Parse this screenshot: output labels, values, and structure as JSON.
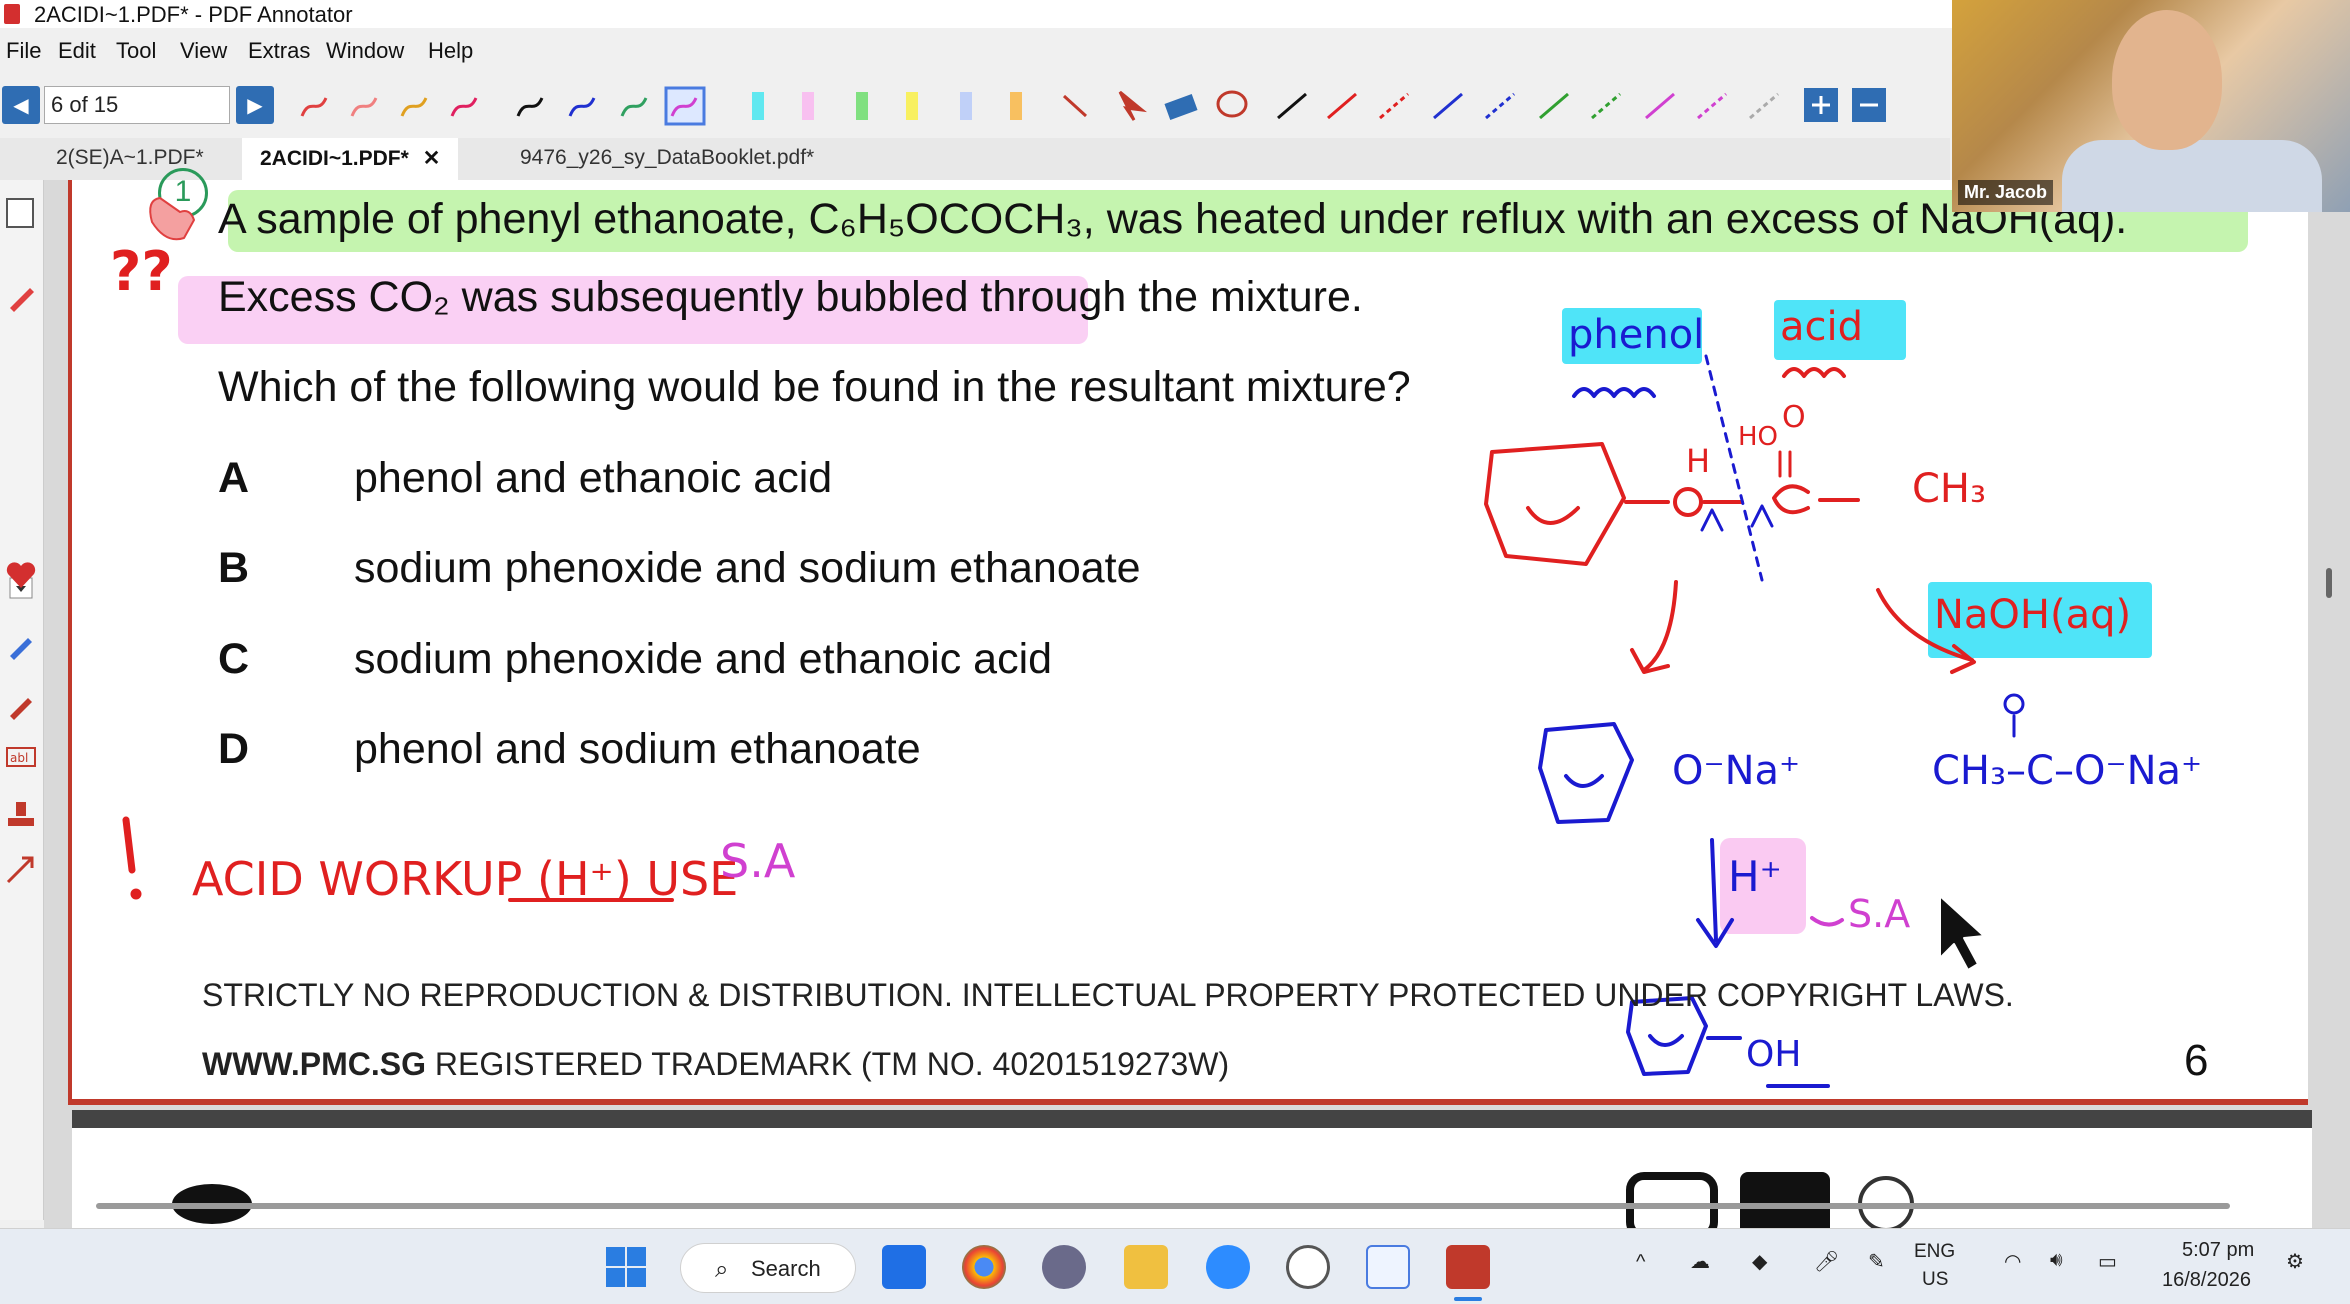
{
  "window": {
    "title": "2ACIDI~1.PDF* - PDF Annotator"
  },
  "menu": [
    "File",
    "Edit",
    "Tool",
    "View",
    "Extras",
    "Window",
    "Help"
  ],
  "toolbar": {
    "page_indicator": "6 of 15"
  },
  "tabs": [
    {
      "label": "2(SE)A~1.PDF*",
      "active": false
    },
    {
      "label": "2ACIDI~1.PDF*",
      "active": true
    },
    {
      "label": "9476_y26_sy_DataBooklet.pdf*",
      "active": false
    }
  ],
  "tab_close": "✕",
  "question": {
    "number": "1",
    "line1": "A sample of phenyl ethanoate, C₆H₅OCOCH₃, was heated under reflux with an excess of NaOH(aq).",
    "line2": "Excess CO₂ was subsequently bubbled through the mixture.",
    "line3": "Which of the following would be found in the resultant mixture?",
    "options": [
      {
        "letter": "A",
        "text": "phenol and ethanoic acid"
      },
      {
        "letter": "B",
        "text": "sodium phenoxide and sodium ethanoate"
      },
      {
        "letter": "C",
        "text": "sodium phenoxide and ethanoic acid"
      },
      {
        "letter": "D",
        "text": "phenol and sodium ethanoate"
      }
    ]
  },
  "footer": {
    "line1": "STRICTLY NO REPRODUCTION & DISTRIBUTION. INTELLECTUAL PROPERTY PROTECTED UNDER COPYRIGHT LAWS.",
    "line2_bold": "WWW.PMC.SG",
    "line2_rest": " REGISTERED TRADEMARK (TM NO. 40201519273W)",
    "page_number": "6"
  },
  "annotations": {
    "exclaim": "??",
    "note_left": "ACID WORKUP (H⁺) USE",
    "note_left_answer": "S.A",
    "phenol_label": "phenol",
    "acid_label": "acid",
    "naoh_label": "NaOH(aq)",
    "h_mark": "H",
    "ho_mark": "HO",
    "carbonyl_o": "O",
    "ch3": "CH₃",
    "product_left": "O⁻Na⁺",
    "product_right": "CH₃–C–O⁻Na⁺",
    "hplus": "H⁺",
    "sa": "S.A",
    "oh": "OH"
  },
  "webcam": {
    "name": "Mr. Jacob"
  },
  "taskbar": {
    "search_label": "Search",
    "lang_top": "ENG",
    "lang_bottom": "US",
    "time": "5:07 pm",
    "date": "16/8/2026"
  },
  "colors": {
    "accent_blue": "#2f6db3",
    "ink_red": "#e02020",
    "ink_blue": "#1a1ad0",
    "highlight_green": "#96eb6e",
    "highlight_pink": "#f596e6",
    "highlight_cyan": "#4fe4f8"
  }
}
